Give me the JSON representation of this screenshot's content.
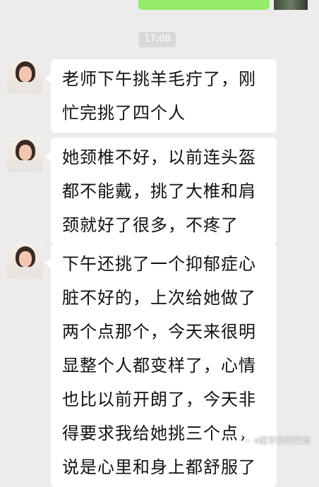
{
  "timestamp": "17:08",
  "messages": [
    {
      "lines": [
        "老师下午挑羊毛疔了，刚",
        "忙完挑了四个人"
      ]
    },
    {
      "lines": [
        "她颈椎不好，以前连头盔",
        "都不能戴，挑了大椎和肩",
        "颈就好了很多，不疼了"
      ]
    },
    {
      "lines": [
        "下午还挑了一个抑郁症心",
        "脏不好的，上次给她做了",
        "两个点那个，今天来很明",
        "显整个人都变样了，心情",
        "也比以前开朗了，今天非",
        "得要求我给她挑三个点，",
        "说是心里和身上都舒服了"
      ]
    }
  ],
  "watermark": {
    "text": "e医学知识交流",
    "icon": "wechat-icon"
  },
  "colors": {
    "background": "#ececec",
    "bubble": "#ffffff",
    "own_bubble": "#95ec69",
    "timestamp_bg": "#d9d9d9"
  }
}
